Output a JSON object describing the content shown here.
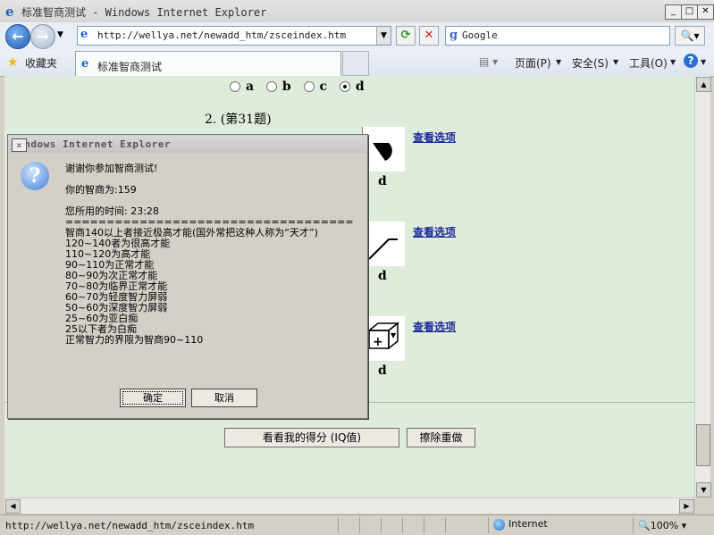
{
  "window": {
    "title": "标准智商测试 - Windows Internet Explorer"
  },
  "address": {
    "url": "http://wellya.net/newadd_htm/zsceindex.htm",
    "search_placeholder": "Google"
  },
  "favorites": {
    "label": "收藏夹",
    "tab_title": "标准智商测试"
  },
  "commands": {
    "page": "页面(P)",
    "safety": "安全(S)",
    "tools": "工具(O)"
  },
  "page": {
    "options": [
      "a",
      "b",
      "c",
      "d"
    ],
    "selected_option": "d",
    "question_label": "2. (第31题)",
    "see_options": "查看选项",
    "answer_label": "d",
    "submit_button": "看看我的得分 (IQ值)",
    "reset_button": "擦除重做"
  },
  "dialog": {
    "title": "Windows Internet Explorer",
    "lines": [
      "谢谢你参加智商测试!",
      "你的智商为:159",
      "您所用的时间: 23:28",
      "===================================",
      "智商140以上者接近极高才能(国外常把这种人称为“天才”)",
      "120~140者为很高才能",
      "110~120为高才能",
      "90~110为正常才能",
      "80~90为次正常才能",
      "70~80为临界正常才能",
      "60~70为轻度智力屏弱",
      "50~60为深度智力屏弱",
      "25~60为亚白痴",
      "25以下者为白痴",
      "正常智力的界限为智商90~110"
    ],
    "ok_button": "确定",
    "cancel_button": "取消"
  },
  "status": {
    "url": "http://wellya.net/newadd_htm/zsceindex.htm",
    "zone": "Internet",
    "zoom": "100%"
  }
}
